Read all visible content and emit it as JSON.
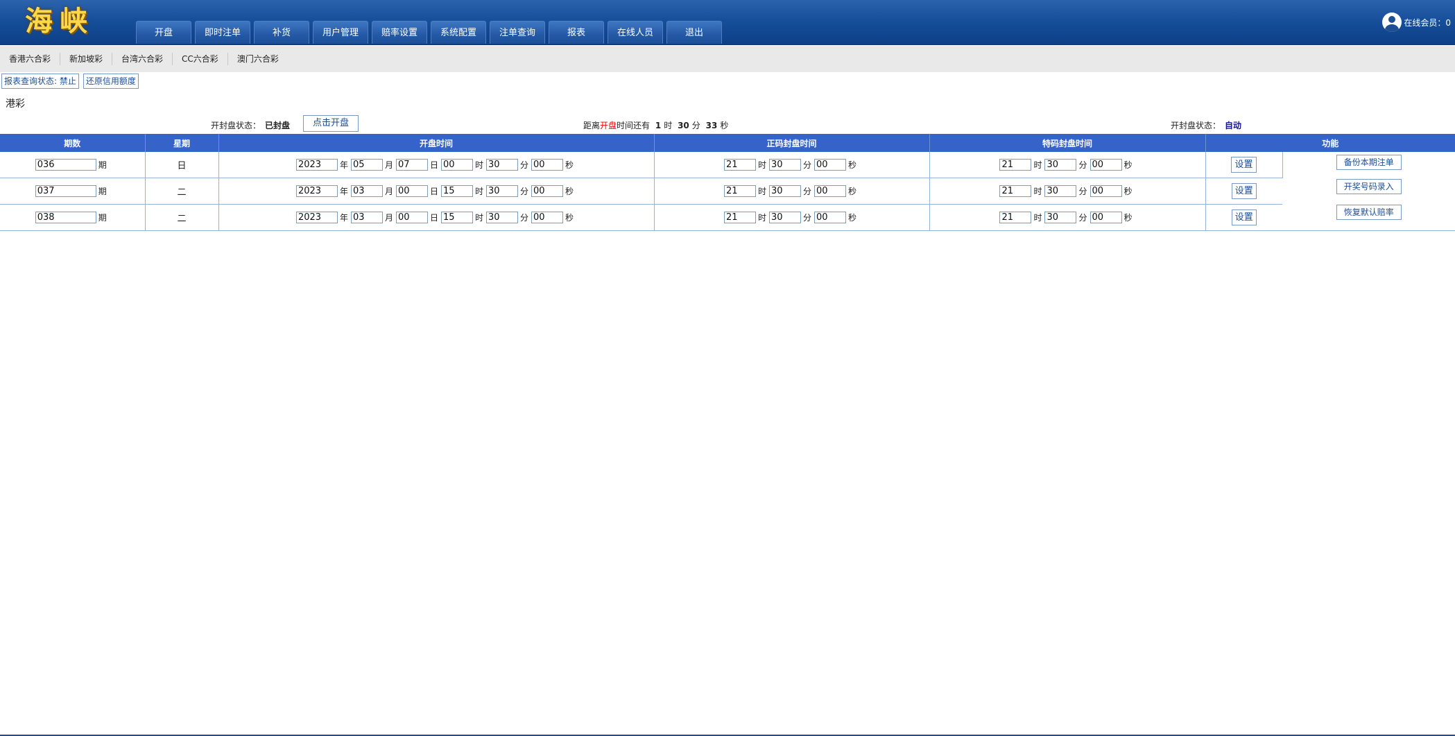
{
  "header": {
    "logo": "海峡",
    "nav": [
      "开盘",
      "即时注单",
      "补货",
      "用户管理",
      "赔率设置",
      "系统配置",
      "注单查询",
      "报表",
      "在线人员",
      "退出"
    ],
    "online_label": "在线会员：0"
  },
  "lottery_tabs": [
    "香港六合彩",
    "新加坡彩",
    "台湾六合彩",
    "CC六合彩",
    "澳门六合彩"
  ],
  "actions": {
    "report_status": "报表查询状态: 禁止",
    "restore_credit": "还原信用额度"
  },
  "section_title": "港彩",
  "status": {
    "label": "开封盘状态：",
    "value": "已封盘",
    "open_button": "点击开盘",
    "countdown_pre": "距离",
    "countdown_red": "开盘",
    "countdown_mid": "时间还有",
    "hours": "1",
    "hour_unit": "时",
    "minutes": "30",
    "minute_unit": "分",
    "seconds": "33",
    "second_unit": "秒",
    "auto_label": "开封盘状态：",
    "auto_value": "自动"
  },
  "table": {
    "headers": [
      "期数",
      "星期",
      "开盘时间",
      "正码封盘时间",
      "特码封盘时间",
      "功能"
    ],
    "units": {
      "issue": "期",
      "year": "年",
      "month": "月",
      "day": "日",
      "hour": "时",
      "minute": "分",
      "second": "秒"
    },
    "set_label": "设置",
    "rows": [
      {
        "issue": "036",
        "weekday": "日",
        "year": "2023",
        "month": "05",
        "day": "07",
        "hour": "00",
        "minute": "30",
        "second": "00",
        "zm_hour": "21",
        "zm_minute": "30",
        "zm_second": "00",
        "tm_hour": "21",
        "tm_minute": "30",
        "tm_second": "00"
      },
      {
        "issue": "037",
        "weekday": "二",
        "year": "2023",
        "month": "03",
        "day": "00",
        "hour": "15",
        "minute": "30",
        "second": "00",
        "zm_hour": "21",
        "zm_minute": "30",
        "zm_second": "00",
        "tm_hour": "21",
        "tm_minute": "30",
        "tm_second": "00"
      },
      {
        "issue": "038",
        "weekday": "二",
        "year": "2023",
        "month": "03",
        "day": "00",
        "hour": "15",
        "minute": "30",
        "second": "00",
        "zm_hour": "21",
        "zm_minute": "30",
        "zm_second": "00",
        "tm_hour": "21",
        "tm_minute": "30",
        "tm_second": "00"
      }
    ],
    "functions": [
      "备份本期注单",
      "开奖号码录入",
      "恢复默认赔率"
    ]
  },
  "colors": {
    "header": "#174f9a",
    "table_header": "#3563c9",
    "accent_red": "#e00000",
    "auto_blue": "#1414a0"
  }
}
